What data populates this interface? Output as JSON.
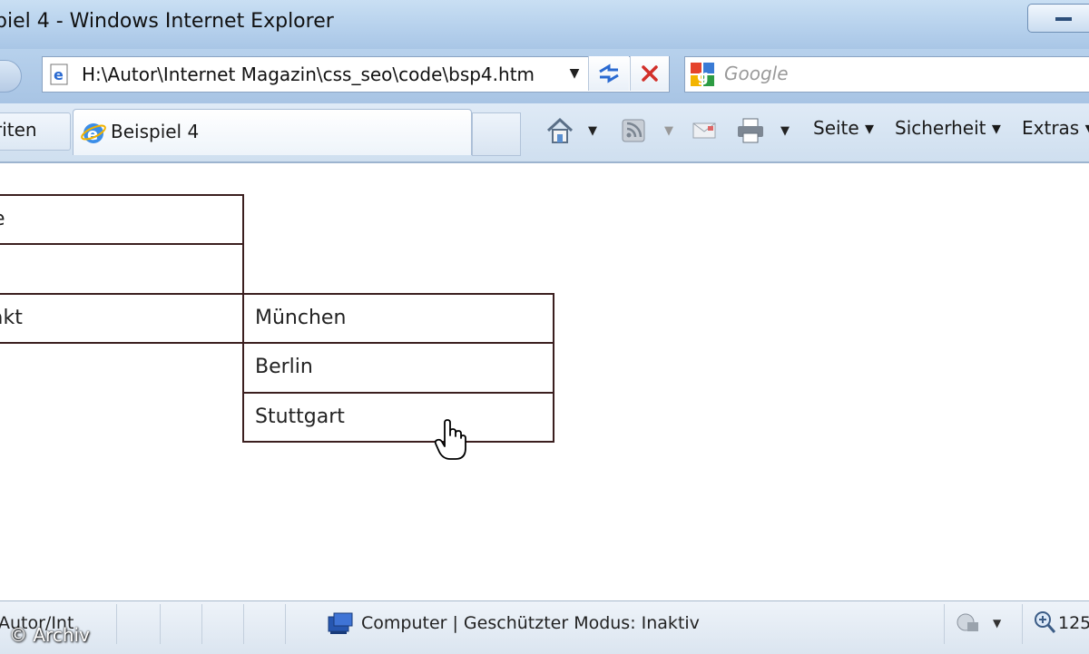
{
  "window": {
    "title": "piel 4 - Windows Internet Explorer"
  },
  "address_bar": {
    "url": "H:\\Autor\\Internet Magazin\\css_seo\\code\\bsp4.htm",
    "dropdown": "▼"
  },
  "search": {
    "placeholder": "Google"
  },
  "favorites": {
    "label": "riten"
  },
  "tab": {
    "label": "Beispiel 4"
  },
  "command_bar": {
    "page": "Seite ▾",
    "security": "Sicherheit ▾",
    "extras": "Extras ▾",
    "drop": "▼"
  },
  "content": {
    "menu": [
      "e",
      "",
      "akt"
    ],
    "submenu": [
      "München",
      "Berlin",
      "Stuttgart"
    ]
  },
  "status": {
    "path": "Autor/Int",
    "zone": "Computer | Geschützter Modus: Inaktiv",
    "protect_drop": "▼",
    "zoom": "125"
  },
  "credit": "© Archiv",
  "colors": {
    "title_bar": "#b5d0ec",
    "table_border": "#3b1f1f",
    "accent": "#2a6ad1"
  }
}
